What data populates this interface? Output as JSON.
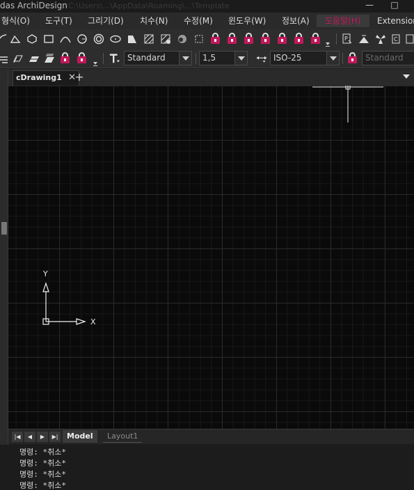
{
  "window": {
    "title": "das ArchiDesign",
    "path": "C:\\Users\\...\\AppData\\Roaming\\...\\Template",
    "minimize_glyph": "—",
    "maximize_glyph": "□"
  },
  "menu": [
    {
      "label": "형식(O)"
    },
    {
      "label": "도구(T)"
    },
    {
      "label": "그리기(D)"
    },
    {
      "label": "치수(N)"
    },
    {
      "label": "수정(M)"
    },
    {
      "label": "윈도우(W)"
    },
    {
      "label": "정보(A)"
    },
    {
      "label": "도움말(H)",
      "active": true
    },
    {
      "label": "Extension"
    }
  ],
  "toolbar2": {
    "text_style": "Standard",
    "text_height": "1,5",
    "dim_style": "ISO-25",
    "table_style": "Standard"
  },
  "icons": {
    "text_style": "text-style-icon",
    "dim_style": "dimension-style-icon",
    "lock": "lock-icon"
  },
  "tabs": {
    "document": "cDrawing1",
    "close_glyph": "✕",
    "add_glyph": "+"
  },
  "canvas": {
    "x_label": "X",
    "y_label": "Y"
  },
  "layout_tabs": {
    "model": "Model",
    "layout1": "Layout1"
  },
  "command_history": [
    "명령: *취소*",
    "명령: *취소*",
    "명령: *취소*",
    "명령: *취소*"
  ],
  "colors": {
    "accent": "#c2185b",
    "canvas": "#0a0a0a",
    "grid_major": "#2a2a2a"
  }
}
